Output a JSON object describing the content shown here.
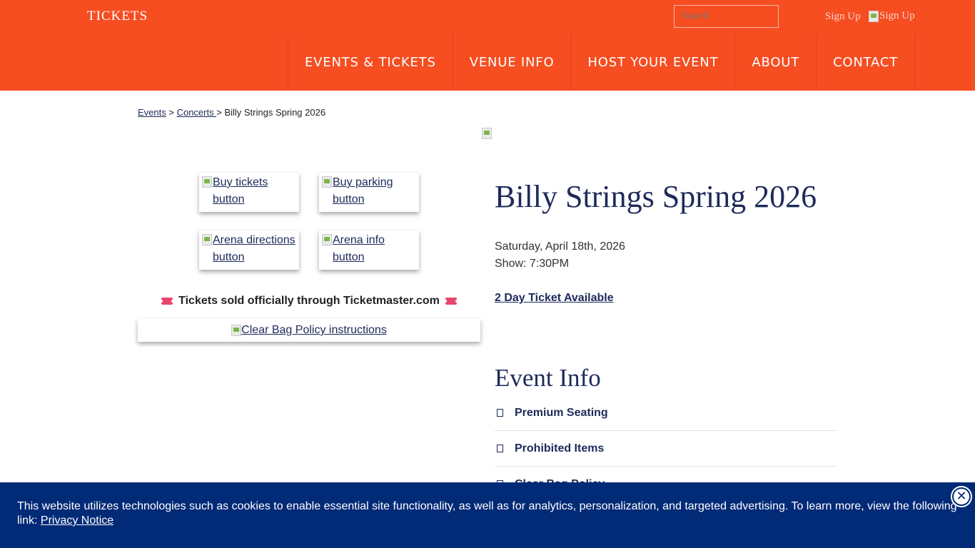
{
  "header": {
    "brand": "TICKETS",
    "search_placeholder": "Search",
    "signup_text": "Sign Up",
    "signup_img_alt": "Sign Up",
    "nav": [
      "EVENTS & TICKETS",
      "VENUE INFO",
      "HOST YOUR EVENT",
      "ABOUT",
      "CONTACT"
    ]
  },
  "breadcrumb": {
    "events": "Events",
    "sep1": " > ",
    "concerts": "Concerts ",
    "sep2": "> ",
    "current": "Billy Strings Spring 2026"
  },
  "buttons": {
    "buy_tickets": "Buy tickets button",
    "buy_parking": "Buy parking button",
    "arena_directions": "Arena directions button",
    "arena_info": "Arena info button"
  },
  "sold_line": "Tickets sold officially through Ticketmaster.com",
  "clear_bag": "Clear Bag Policy instructions",
  "event": {
    "title": "Billy Strings Spring 2026",
    "date": "Saturday, April 18th, 2026",
    "show": "Show: 7:30PM",
    "two_day": "2 Day Ticket Available"
  },
  "event_info": {
    "heading": "Event Info",
    "items": [
      "Premium Seating",
      "Prohibited Items",
      "Clear Bag Policy"
    ]
  },
  "cookie": {
    "text": "This website utilizes technologies such as cookies to enable essential site functionality, as well as for analytics, personalization, and targeted advertising. To learn more, view the following link: ",
    "link": "Privacy Notice",
    "close_glyph": "✕"
  },
  "colors": {
    "header_bg": "#f64d21",
    "navy": "#1e2a5a",
    "cookie_bg": "#012a77",
    "ticket_pink": "#e8466e"
  }
}
